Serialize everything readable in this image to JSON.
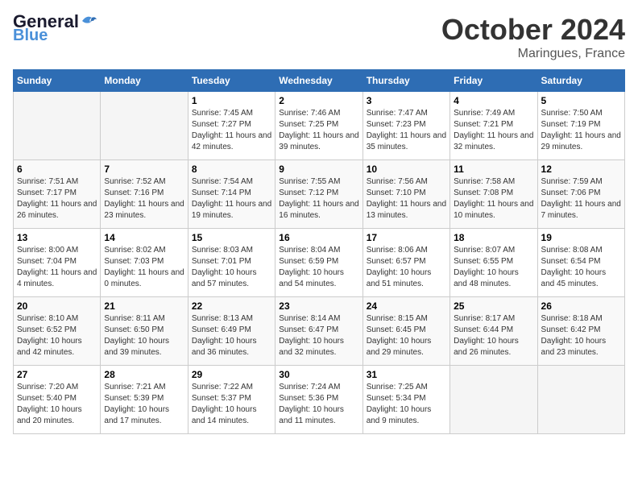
{
  "logo": {
    "general": "General",
    "blue": "Blue",
    "bird_symbol": "▶"
  },
  "header": {
    "month": "October 2024",
    "location": "Maringues, France"
  },
  "weekdays": [
    "Sunday",
    "Monday",
    "Tuesday",
    "Wednesday",
    "Thursday",
    "Friday",
    "Saturday"
  ],
  "weeks": [
    [
      {
        "day": null,
        "data": null
      },
      {
        "day": null,
        "data": null
      },
      {
        "day": "1",
        "data": "Sunrise: 7:45 AM\nSunset: 7:27 PM\nDaylight: 11 hours and 42 minutes."
      },
      {
        "day": "2",
        "data": "Sunrise: 7:46 AM\nSunset: 7:25 PM\nDaylight: 11 hours and 39 minutes."
      },
      {
        "day": "3",
        "data": "Sunrise: 7:47 AM\nSunset: 7:23 PM\nDaylight: 11 hours and 35 minutes."
      },
      {
        "day": "4",
        "data": "Sunrise: 7:49 AM\nSunset: 7:21 PM\nDaylight: 11 hours and 32 minutes."
      },
      {
        "day": "5",
        "data": "Sunrise: 7:50 AM\nSunset: 7:19 PM\nDaylight: 11 hours and 29 minutes."
      }
    ],
    [
      {
        "day": "6",
        "data": "Sunrise: 7:51 AM\nSunset: 7:17 PM\nDaylight: 11 hours and 26 minutes."
      },
      {
        "day": "7",
        "data": "Sunrise: 7:52 AM\nSunset: 7:16 PM\nDaylight: 11 hours and 23 minutes."
      },
      {
        "day": "8",
        "data": "Sunrise: 7:54 AM\nSunset: 7:14 PM\nDaylight: 11 hours and 19 minutes."
      },
      {
        "day": "9",
        "data": "Sunrise: 7:55 AM\nSunset: 7:12 PM\nDaylight: 11 hours and 16 minutes."
      },
      {
        "day": "10",
        "data": "Sunrise: 7:56 AM\nSunset: 7:10 PM\nDaylight: 11 hours and 13 minutes."
      },
      {
        "day": "11",
        "data": "Sunrise: 7:58 AM\nSunset: 7:08 PM\nDaylight: 11 hours and 10 minutes."
      },
      {
        "day": "12",
        "data": "Sunrise: 7:59 AM\nSunset: 7:06 PM\nDaylight: 11 hours and 7 minutes."
      }
    ],
    [
      {
        "day": "13",
        "data": "Sunrise: 8:00 AM\nSunset: 7:04 PM\nDaylight: 11 hours and 4 minutes."
      },
      {
        "day": "14",
        "data": "Sunrise: 8:02 AM\nSunset: 7:03 PM\nDaylight: 11 hours and 0 minutes."
      },
      {
        "day": "15",
        "data": "Sunrise: 8:03 AM\nSunset: 7:01 PM\nDaylight: 10 hours and 57 minutes."
      },
      {
        "day": "16",
        "data": "Sunrise: 8:04 AM\nSunset: 6:59 PM\nDaylight: 10 hours and 54 minutes."
      },
      {
        "day": "17",
        "data": "Sunrise: 8:06 AM\nSunset: 6:57 PM\nDaylight: 10 hours and 51 minutes."
      },
      {
        "day": "18",
        "data": "Sunrise: 8:07 AM\nSunset: 6:55 PM\nDaylight: 10 hours and 48 minutes."
      },
      {
        "day": "19",
        "data": "Sunrise: 8:08 AM\nSunset: 6:54 PM\nDaylight: 10 hours and 45 minutes."
      }
    ],
    [
      {
        "day": "20",
        "data": "Sunrise: 8:10 AM\nSunset: 6:52 PM\nDaylight: 10 hours and 42 minutes."
      },
      {
        "day": "21",
        "data": "Sunrise: 8:11 AM\nSunset: 6:50 PM\nDaylight: 10 hours and 39 minutes."
      },
      {
        "day": "22",
        "data": "Sunrise: 8:13 AM\nSunset: 6:49 PM\nDaylight: 10 hours and 36 minutes."
      },
      {
        "day": "23",
        "data": "Sunrise: 8:14 AM\nSunset: 6:47 PM\nDaylight: 10 hours and 32 minutes."
      },
      {
        "day": "24",
        "data": "Sunrise: 8:15 AM\nSunset: 6:45 PM\nDaylight: 10 hours and 29 minutes."
      },
      {
        "day": "25",
        "data": "Sunrise: 8:17 AM\nSunset: 6:44 PM\nDaylight: 10 hours and 26 minutes."
      },
      {
        "day": "26",
        "data": "Sunrise: 8:18 AM\nSunset: 6:42 PM\nDaylight: 10 hours and 23 minutes."
      }
    ],
    [
      {
        "day": "27",
        "data": "Sunrise: 7:20 AM\nSunset: 5:40 PM\nDaylight: 10 hours and 20 minutes."
      },
      {
        "day": "28",
        "data": "Sunrise: 7:21 AM\nSunset: 5:39 PM\nDaylight: 10 hours and 17 minutes."
      },
      {
        "day": "29",
        "data": "Sunrise: 7:22 AM\nSunset: 5:37 PM\nDaylight: 10 hours and 14 minutes."
      },
      {
        "day": "30",
        "data": "Sunrise: 7:24 AM\nSunset: 5:36 PM\nDaylight: 10 hours and 11 minutes."
      },
      {
        "day": "31",
        "data": "Sunrise: 7:25 AM\nSunset: 5:34 PM\nDaylight: 10 hours and 9 minutes."
      },
      {
        "day": null,
        "data": null
      },
      {
        "day": null,
        "data": null
      }
    ]
  ]
}
